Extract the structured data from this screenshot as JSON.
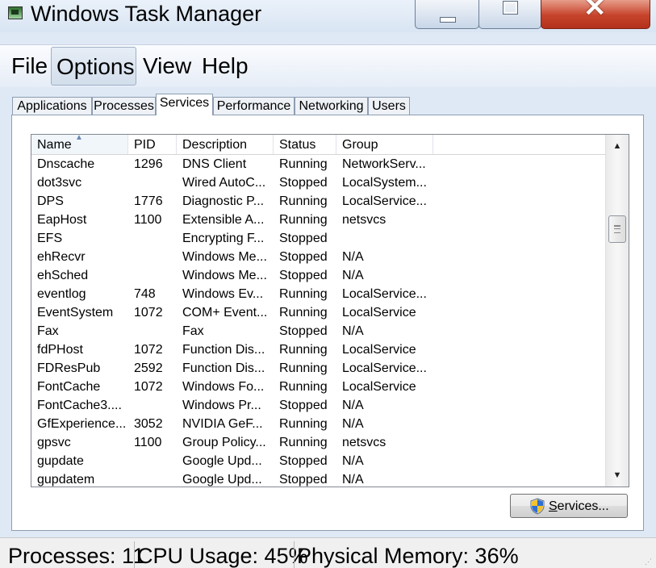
{
  "window": {
    "title": "Windows Task Manager"
  },
  "menu": {
    "file": "File",
    "options": "Options",
    "view": "View",
    "help": "Help"
  },
  "tabs": [
    {
      "label": "Applications",
      "active": false
    },
    {
      "label": "Processes",
      "active": false
    },
    {
      "label": "Services",
      "active": true
    },
    {
      "label": "Performance",
      "active": false
    },
    {
      "label": "Networking",
      "active": false
    },
    {
      "label": "Users",
      "active": false
    }
  ],
  "services": {
    "columns": {
      "name": "Name",
      "pid": "PID",
      "description": "Description",
      "status": "Status",
      "group": "Group"
    },
    "sorted_column": "Name",
    "rows": [
      {
        "name": "Dnscache",
        "pid": "1296",
        "description": "DNS Client",
        "status": "Running",
        "group": "NetworkServ..."
      },
      {
        "name": "dot3svc",
        "pid": "",
        "description": "Wired AutoC...",
        "status": "Stopped",
        "group": "LocalSystem..."
      },
      {
        "name": "DPS",
        "pid": "1776",
        "description": "Diagnostic P...",
        "status": "Running",
        "group": "LocalService..."
      },
      {
        "name": "EapHost",
        "pid": "1100",
        "description": "Extensible A...",
        "status": "Running",
        "group": "netsvcs"
      },
      {
        "name": "EFS",
        "pid": "",
        "description": "Encrypting F...",
        "status": "Stopped",
        "group": ""
      },
      {
        "name": "ehRecvr",
        "pid": "",
        "description": "Windows Me...",
        "status": "Stopped",
        "group": "N/A"
      },
      {
        "name": "ehSched",
        "pid": "",
        "description": "Windows Me...",
        "status": "Stopped",
        "group": "N/A"
      },
      {
        "name": "eventlog",
        "pid": "748",
        "description": "Windows Ev...",
        "status": "Running",
        "group": "LocalService..."
      },
      {
        "name": "EventSystem",
        "pid": "1072",
        "description": "COM+ Event...",
        "status": "Running",
        "group": "LocalService"
      },
      {
        "name": "Fax",
        "pid": "",
        "description": "Fax",
        "status": "Stopped",
        "group": "N/A"
      },
      {
        "name": "fdPHost",
        "pid": "1072",
        "description": "Function Dis...",
        "status": "Running",
        "group": "LocalService"
      },
      {
        "name": "FDResPub",
        "pid": "2592",
        "description": "Function Dis...",
        "status": "Running",
        "group": "LocalService..."
      },
      {
        "name": "FontCache",
        "pid": "1072",
        "description": "Windows Fo...",
        "status": "Running",
        "group": "LocalService"
      },
      {
        "name": "FontCache3....",
        "pid": "",
        "description": "Windows Pr...",
        "status": "Stopped",
        "group": "N/A"
      },
      {
        "name": "GfExperience...",
        "pid": "3052",
        "description": "NVIDIA GeF...",
        "status": "Running",
        "group": "N/A"
      },
      {
        "name": "gpsvc",
        "pid": "1100",
        "description": "Group Policy...",
        "status": "Running",
        "group": "netsvcs"
      },
      {
        "name": "gupdate",
        "pid": "",
        "description": "Google Upd...",
        "status": "Stopped",
        "group": "N/A"
      },
      {
        "name": "gupdatem",
        "pid": "",
        "description": "Google Upd...",
        "status": "Stopped",
        "group": "N/A"
      }
    ]
  },
  "buttons": {
    "services": "Services..."
  },
  "status_bar": {
    "processes": "Processes: 11",
    "cpu": "CPU Usage: 45%",
    "memory": "Physical Memory: 36%"
  },
  "icons": {
    "app": "task-manager-icon",
    "services_button": "uac-shield-icon",
    "sort": "sort-ascending-icon"
  }
}
